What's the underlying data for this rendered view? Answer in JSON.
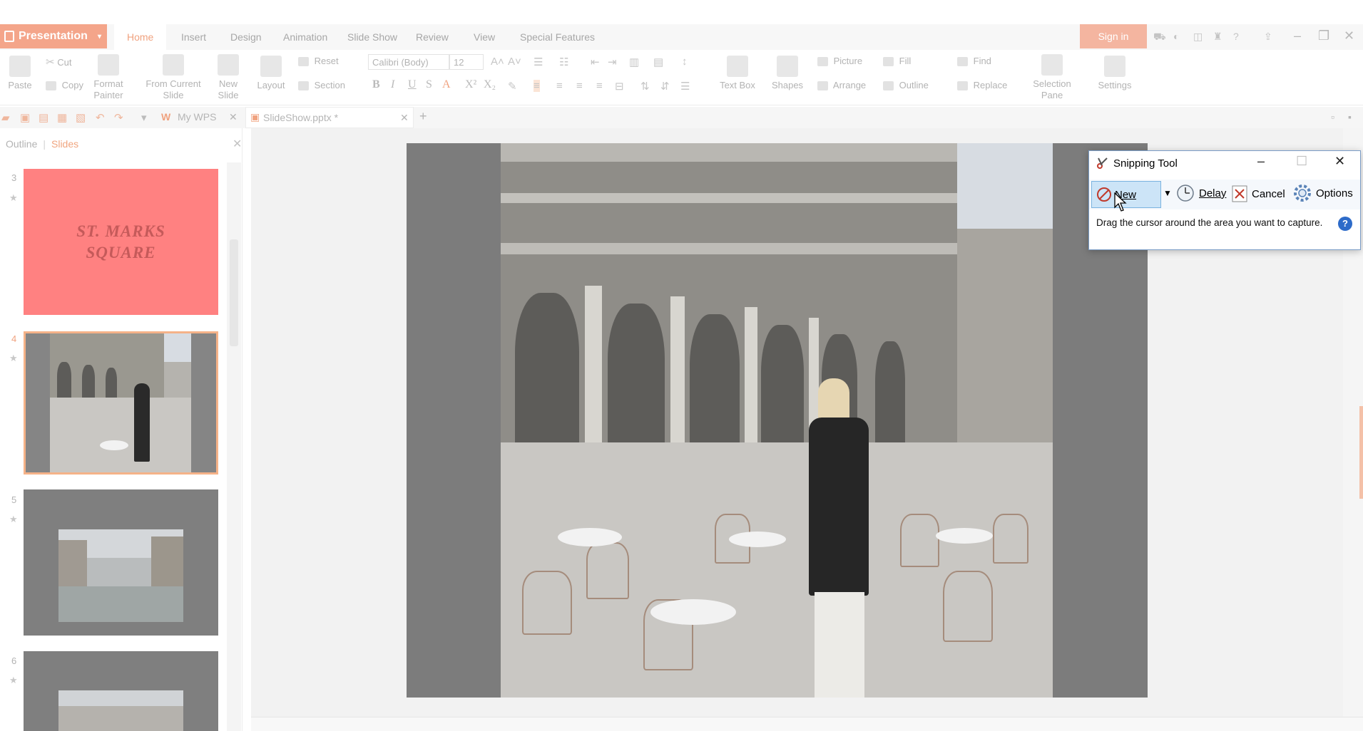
{
  "app": {
    "name": "Presentation",
    "sign_in": "Sign in"
  },
  "menu": {
    "tabs": [
      "Home",
      "Insert",
      "Design",
      "Animation",
      "Slide Show",
      "Review",
      "View",
      "Special Features"
    ],
    "active_tab": "Home"
  },
  "ribbon": {
    "paste": "Paste",
    "cut": "Cut",
    "copy": "Copy",
    "format_painter_1": "Format",
    "format_painter_2": "Painter",
    "from_current_1": "From Current",
    "from_current_2": "Slide",
    "new_slide_1": "New",
    "new_slide_2": "Slide",
    "layout": "Layout",
    "reset": "Reset",
    "section": "Section",
    "font_name": "Calibri (Body)",
    "font_size": "12",
    "text_box": "Text Box",
    "shapes": "Shapes",
    "picture": "Picture",
    "fill": "Fill",
    "arrange": "Arrange",
    "outline": "Outline",
    "find": "Find",
    "replace": "Replace",
    "selection_pane_1": "Selection",
    "selection_pane_2": "Pane",
    "settings": "Settings"
  },
  "doc_tabs": {
    "my_wps": "My WPS",
    "active_file": "SlideShow.pptx *"
  },
  "left_panel": {
    "outline": "Outline",
    "slides": "Slides",
    "title_slide_text_1": "ST. MARKS",
    "title_slide_text_2": "SQUARE",
    "slide_numbers": [
      "3",
      "4",
      "5",
      "6"
    ]
  },
  "snipping_tool": {
    "title": "Snipping Tool",
    "new": "New",
    "delay": "Delay",
    "cancel": "Cancel",
    "options": "Options",
    "message": "Drag the cursor around the area you want to capture.",
    "help": "?"
  }
}
